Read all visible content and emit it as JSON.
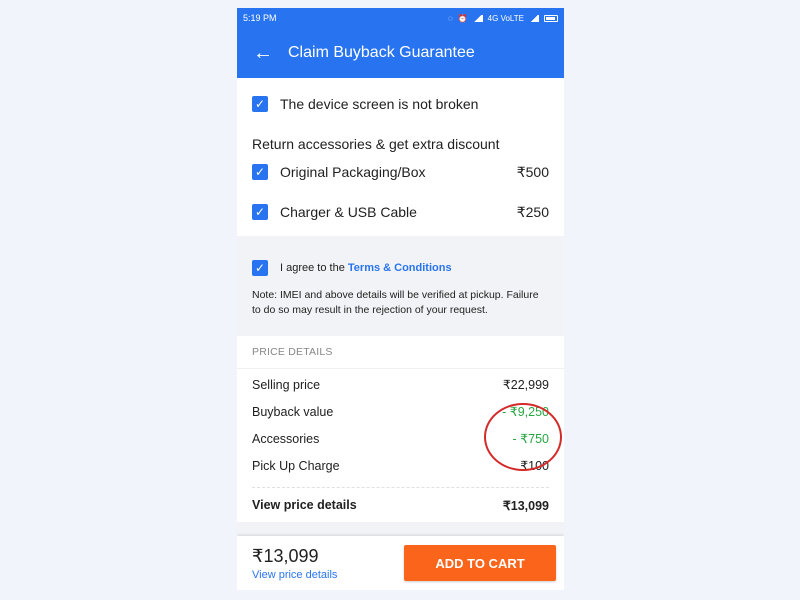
{
  "status_bar": {
    "time": "5:19 PM",
    "network": "4G VoLTE"
  },
  "header": {
    "title": "Claim Buyback Guarantee",
    "back_icon": "arrow-left-icon"
  },
  "conditions": {
    "screen_check": "The device screen is not broken",
    "accessories_heading": "Return accessories & get extra discount",
    "accessories": [
      {
        "label": "Original Packaging/Box",
        "price": "₹500",
        "checked": true
      },
      {
        "label": "Charger & USB Cable",
        "price": "₹250",
        "checked": true
      }
    ]
  },
  "agreement": {
    "prefix": "I agree to the",
    "link": "Terms & Conditions",
    "note": "Note: IMEI and above details will be verified at pickup. Failure to do so may result in the rejection of your request."
  },
  "price_details": {
    "heading": "PRICE DETAILS",
    "rows": [
      {
        "label": "Selling price",
        "value": "₹22,999"
      },
      {
        "label": "Buyback value",
        "value": "- ₹9,250"
      },
      {
        "label": "Accessories",
        "value": "- ₹750"
      },
      {
        "label": "Pick Up Charge",
        "value": "₹100"
      }
    ],
    "total_label": "View price details",
    "total_value": "₹13,099"
  },
  "footer": {
    "total": "₹13,099",
    "view_link": "View price details",
    "cta": "ADD TO CART"
  },
  "colors": {
    "primary": "#2874f0",
    "cta": "#fb641b",
    "discount": "#26a541",
    "annotation": "#d42a2a"
  }
}
